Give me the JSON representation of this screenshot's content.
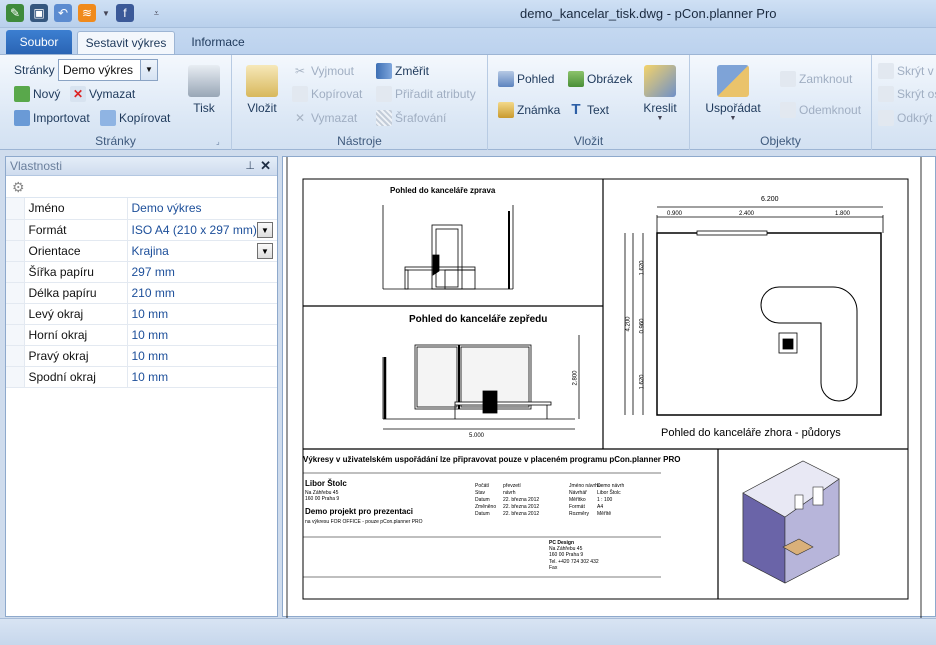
{
  "window": {
    "title": "demo_kancelar_tisk.dwg - pCon.planner Pro"
  },
  "tabs": [
    {
      "label": "Soubor"
    },
    {
      "label": "Sestavit výkres"
    },
    {
      "label": "Informace"
    }
  ],
  "ribbon": {
    "pages": {
      "label": "Stránky",
      "combo_label": "Stránky",
      "combo_value": "Demo výkres",
      "new": "Nový",
      "delete": "Vymazat",
      "import": "Importovat",
      "copy": "Kopírovat",
      "print": "Tisk"
    },
    "tools": {
      "label": "Nástroje",
      "paste": "Vložit",
      "cut": "Vyjmout",
      "copy": "Kopírovat",
      "delete": "Vymazat",
      "measure": "Změřit",
      "assign_attrs": "Přiřadit atributy",
      "hatching": "Šrafování"
    },
    "insert": {
      "label": "Vložit",
      "view": "Pohled",
      "image": "Obrázek",
      "note": "Známka",
      "text": "Text",
      "draw": "Kreslit"
    },
    "objects": {
      "label": "Objekty",
      "arrange": "Uspořádat",
      "lock": "Zamknout",
      "unlock": "Odemknout",
      "hide1": "Skrýt v",
      "hide2": "Skrýt os",
      "unhide": "Odkrýt"
    }
  },
  "properties_panel": {
    "title": "Vlastnosti",
    "rows": [
      {
        "key": "Jméno",
        "value": "Demo výkres",
        "dropdown": false
      },
      {
        "key": "Formát",
        "value": "ISO A4 (210 x 297 mm)",
        "dropdown": true
      },
      {
        "key": "Orientace",
        "value": "Krajina",
        "dropdown": true
      },
      {
        "key": "Šířka papíru",
        "value": "297 mm",
        "dropdown": false
      },
      {
        "key": "Délka papíru",
        "value": "210 mm",
        "dropdown": false
      },
      {
        "key": "Levý okraj",
        "value": "10 mm",
        "dropdown": false
      },
      {
        "key": "Horní okraj",
        "value": "10 mm",
        "dropdown": false
      },
      {
        "key": "Pravý okraj",
        "value": "10 mm",
        "dropdown": false
      },
      {
        "key": "Spodní okraj",
        "value": "10 mm",
        "dropdown": false
      }
    ]
  },
  "drawing": {
    "view_right": "Pohled do kanceláře zprava",
    "view_front": "Pohled do kanceláře zepředu",
    "view_top": "Pohled do kanceláře zhora - půdorys",
    "dim_total": "6.200",
    "dim_a": "0.900",
    "dim_b": "2.400",
    "dim_c": "1.800",
    "dim_height": "4.200",
    "dim_front_w": "5.000",
    "dim_front_h": "2.800",
    "dim_side_1": "1.620",
    "dim_side_2": "0.960",
    "dim_side_3": "1.620",
    "note": "Výkresy v uživatelském uspořádání lze připravovat pouze v placeném programu pCon.planner PRO",
    "author": "Libor Štolc",
    "address1": "Na Záhřebu 45",
    "address2": "160 00 Praha 9",
    "project": "Demo projekt pro prezentaci",
    "project_sub": "na výkresu FOR OFFICE - pouze pCon.planner PRO",
    "tb_labels": [
      "Počátí",
      "Stav",
      "Datum",
      "Změněno",
      "Datum"
    ],
    "tb_values": [
      "převzetí",
      "návrh",
      "22. března 2012",
      "22. března 2012",
      "22. března 2012"
    ],
    "tb_labels2": [
      "Jméno návrhu",
      "Návrhář",
      "Měřítko",
      "Formát",
      "Rozměry"
    ],
    "tb_values2": [
      "Demo návrh",
      "Libor Štolc",
      "1 : 100",
      "A4",
      "Měřítě"
    ],
    "company": "PC Design",
    "company_addr1": "Na Záhřebu 45",
    "company_addr2": "160 00 Praha 9",
    "company_tel": "Tel. +420 724 302 432",
    "company_fax": "Fax"
  },
  "colors": {
    "accent": "#2a64b4",
    "link_text": "#1d4f9a"
  }
}
